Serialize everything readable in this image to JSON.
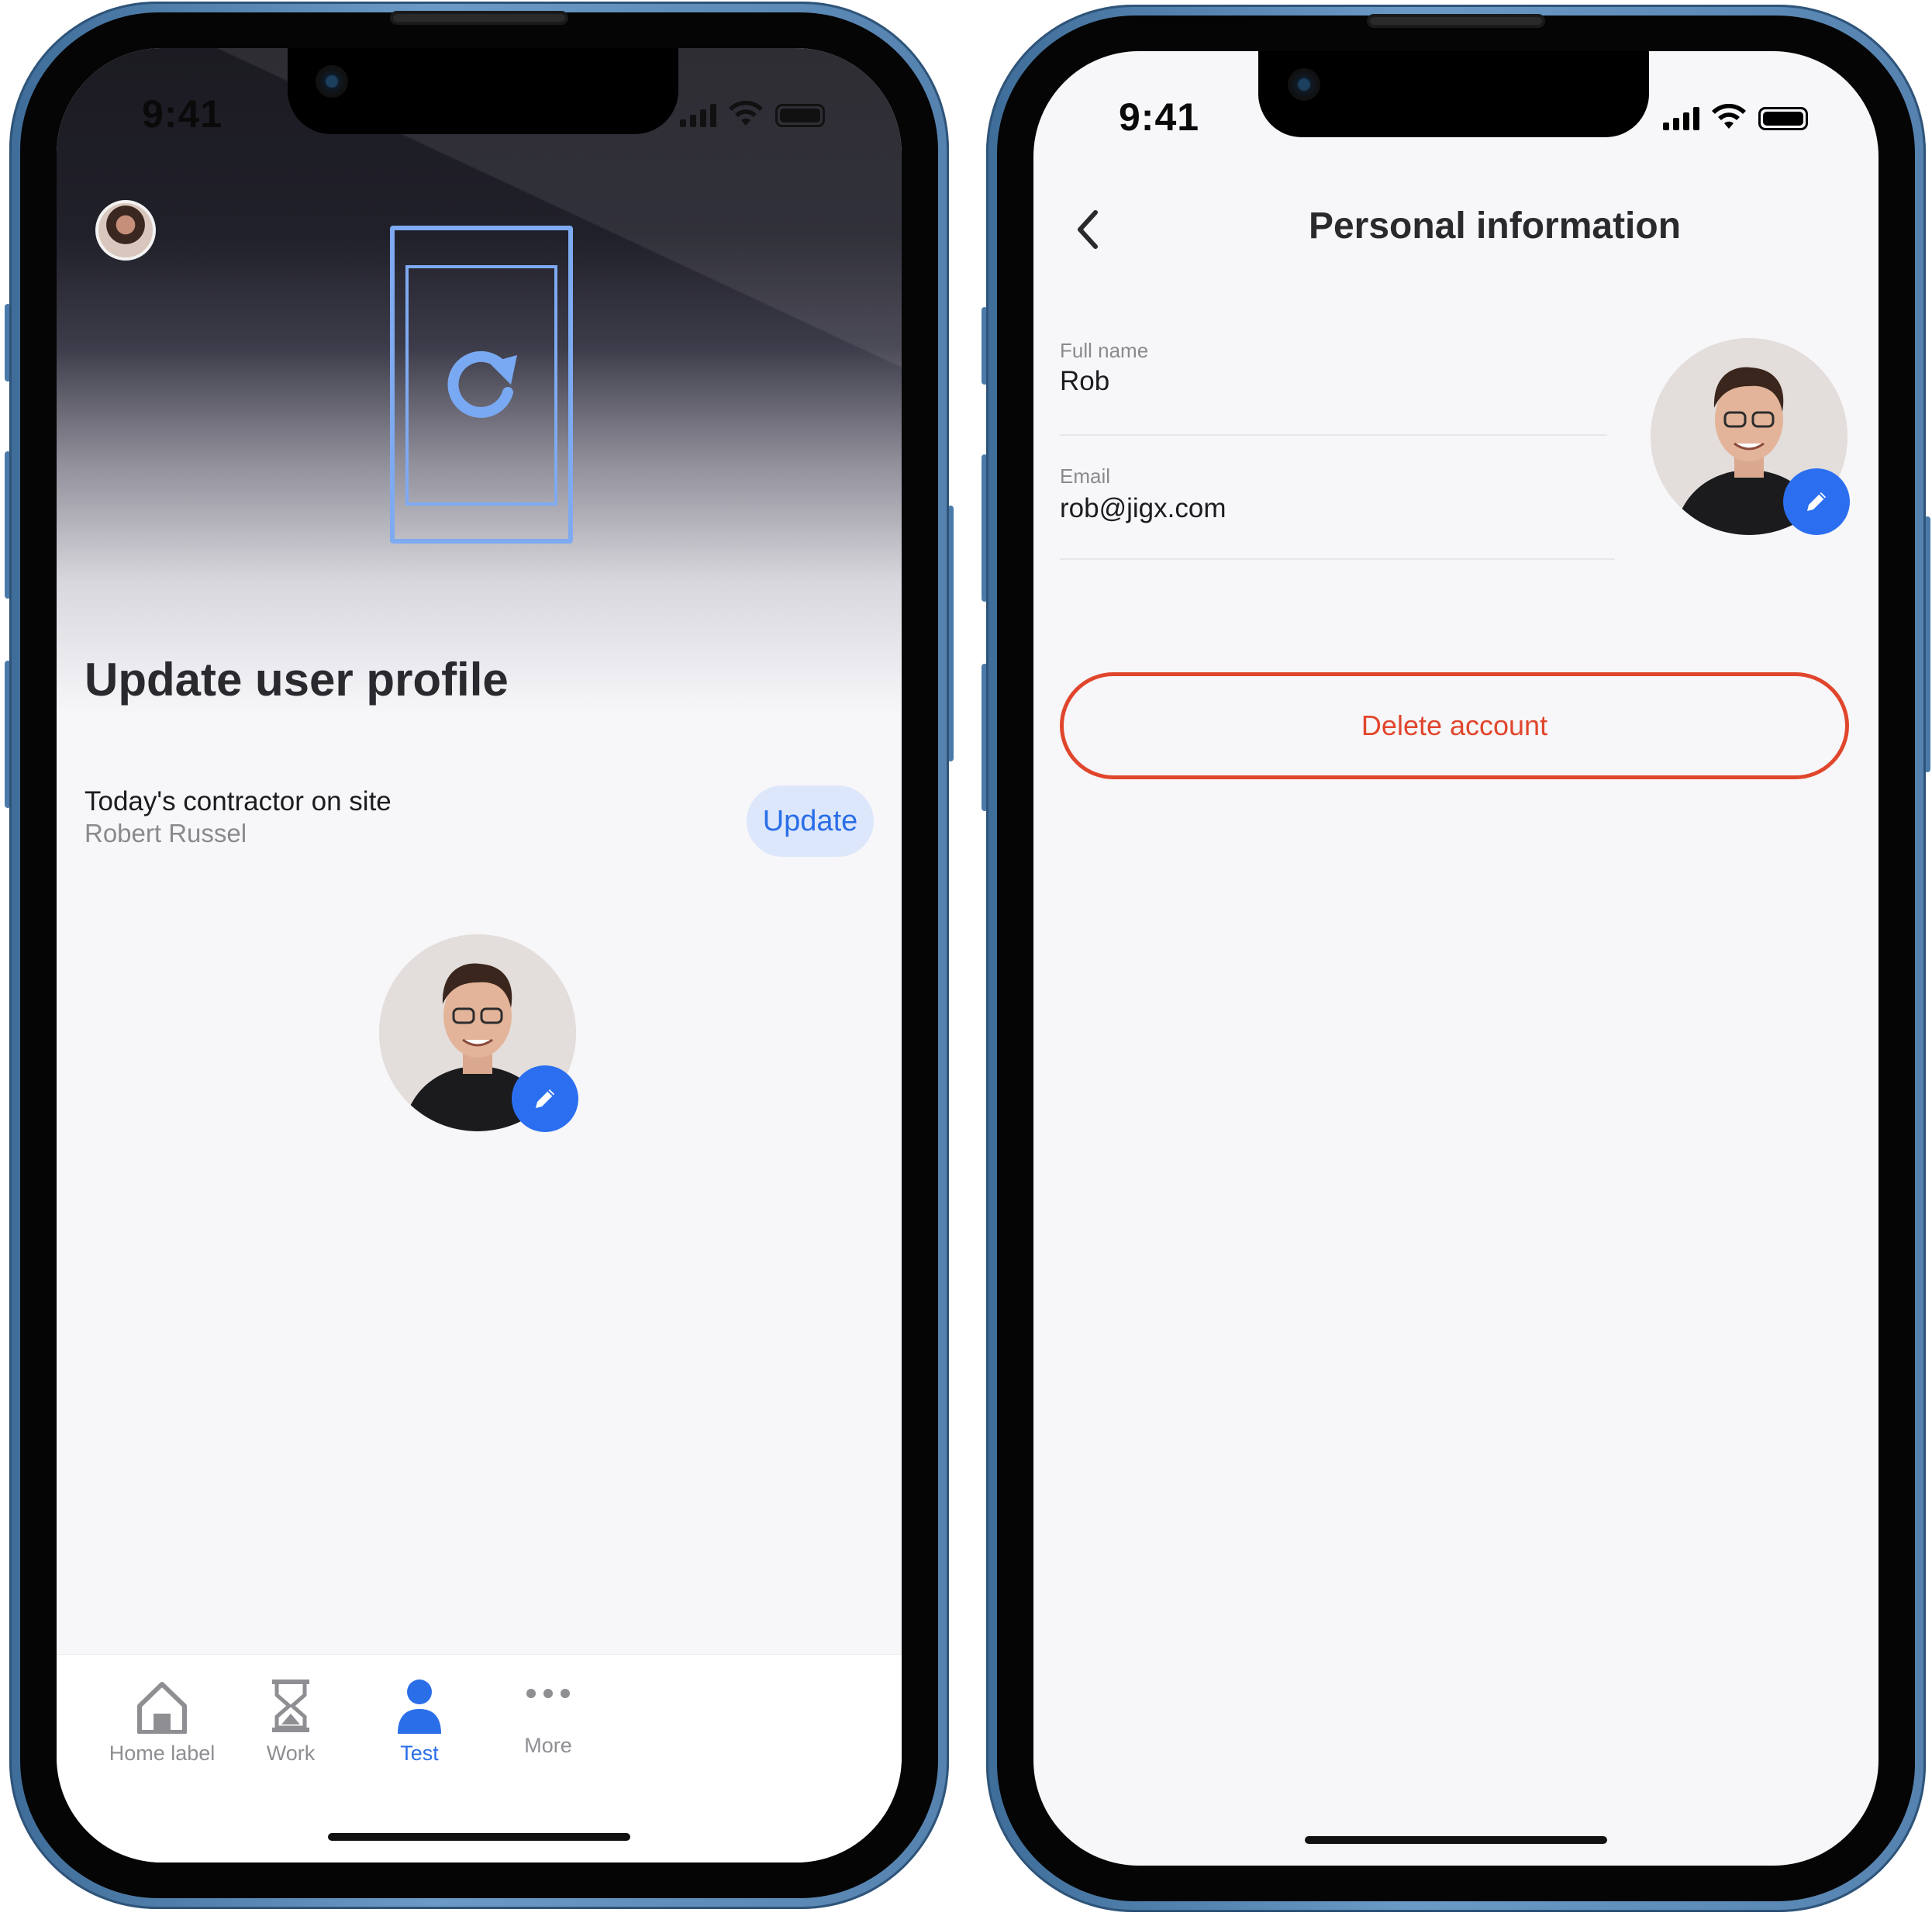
{
  "left_phone": {
    "status_time": "9:41",
    "page_title": "Update user profile",
    "contractor": {
      "label": "Today's contractor on site",
      "name": "Robert Russel",
      "update_button": "Update"
    },
    "tabs": [
      {
        "label": "Home label",
        "icon": "house-icon",
        "active": false
      },
      {
        "label": "Work",
        "icon": "hourglass-icon",
        "active": false
      },
      {
        "label": "Test",
        "icon": "person-icon",
        "active": true
      },
      {
        "label": "More",
        "icon": "more-icon",
        "active": false
      }
    ]
  },
  "right_phone": {
    "status_time": "9:41",
    "nav_title": "Personal information",
    "fields": [
      {
        "label": "Full name",
        "value": "Rob"
      },
      {
        "label": "Email",
        "value": "rob@jigx.com"
      }
    ],
    "delete_button": "Delete account"
  },
  "colors": {
    "accent_blue": "#2a6ee8",
    "destructive_red": "#e0462c",
    "screen_bg": "#f7f6f9",
    "frame_blue": "#4a7aa9"
  }
}
